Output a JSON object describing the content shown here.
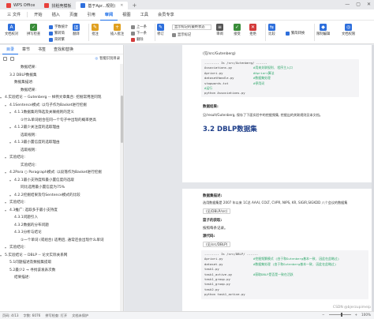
{
  "titlebar": {
    "tabs": [
      {
        "label": "WPS Office",
        "color": "#e8413c",
        "active": false
      },
      {
        "label": "找稻壳模板",
        "color": "#e8413c",
        "active": false
      },
      {
        "label": "基于Apr...规则)",
        "color": "#2e6fdc",
        "active": true
      }
    ],
    "new_tab": "+"
  },
  "menubar": {
    "file": "三 文件",
    "items": [
      "开始",
      "插入",
      "页面",
      "引用",
      "审阅",
      "视图",
      "工具",
      "会员专享"
    ],
    "active": "审阅"
  },
  "ribbon": {
    "buttons": [
      {
        "label": "文档校对",
        "color": "#2e6fdc",
        "glyph": "A"
      },
      {
        "label": "拼写检查",
        "color": "#3a8d3a",
        "glyph": "✓"
      },
      {
        "label": "翻译",
        "color": "#2e6fdc",
        "glyph": "译"
      },
      {
        "label": "批注",
        "color": "#e0a020",
        "glyph": "✎"
      },
      {
        "label": "插入批注",
        "color": "#e0a020",
        "glyph": "+"
      },
      {
        "label": "修订",
        "color": "#2e6fdc",
        "glyph": "✎"
      },
      {
        "label": "审阅",
        "color": "#555555",
        "glyph": "≡"
      },
      {
        "label": "接受",
        "color": "#3a8d3a",
        "glyph": "✓"
      },
      {
        "label": "拒绝",
        "color": "#d33a3a",
        "glyph": "✕"
      },
      {
        "label": "比较",
        "color": "#2e6fdc",
        "glyph": "⇆"
      },
      {
        "label": "限制编辑",
        "color": "#2e6fdc",
        "glyph": "🔒"
      },
      {
        "label": "文档权限",
        "color": "#2e6fdc",
        "glyph": "◎"
      }
    ],
    "small": [
      "字数统计",
      "繁转简",
      "简转繁",
      "显示标记的最终状态",
      "显示标记",
      "上一条",
      "下一条",
      "删除",
      "繁简转换"
    ],
    "combo_value": "显示标记的最终状态"
  },
  "nav": {
    "tabs": [
      "目录",
      "章节",
      "书签",
      "查找和替换"
    ],
    "active_tab": "目录",
    "smart_button": "智能识别目录",
    "items": [
      {
        "text": "数据结果:",
        "level": 4
      },
      {
        "text": "3.2 DBLP数据集",
        "level": 2
      },
      {
        "text": "数据集描述:",
        "level": 3
      },
      {
        "text": "数据结果:",
        "level": 4
      },
      {
        "text": "4.实验结论 -- Gutenberg -- 样例文章集合: 挖掘常用连同现",
        "level": 1,
        "arrow": true
      },
      {
        "text": "4.1Sentence模式: 以句子作为Basket进行挖掘",
        "level": 2,
        "arrow": true
      },
      {
        "text": "4.1.1数据集的筛选及关联规则的定义",
        "level": 3,
        "arrow": true
      },
      {
        "text": "①什么单词组合在同一个句子中出现的概率更高",
        "level": 4
      },
      {
        "text": "4.1.2最少关注度的选取理由",
        "level": 3,
        "arrow": true
      },
      {
        "text": "选取规则:",
        "level": 4
      },
      {
        "text": "4.1.3最小置信度的选取理由",
        "level": 3,
        "arrow": true
      },
      {
        "text": "选取规则:",
        "level": 4
      },
      {
        "text": "实验结论:",
        "level": 2,
        "arrow": true
      },
      {
        "text": "实验结论:",
        "level": 4
      },
      {
        "text": "4.2Para ○ Paragraph模式: 以段落作为Basket进行挖掘",
        "level": 2,
        "arrow": true
      },
      {
        "text": "4.2.1最小支持度和最小置信度的选取",
        "level": 3,
        "arrow": true
      },
      {
        "text": "同比选用最小置信度为75%",
        "level": 4
      },
      {
        "text": "4.2.2挖掘结果及句Sentence模式的比较",
        "level": 3,
        "arrow": true
      },
      {
        "text": "实验结论:",
        "level": 2,
        "arrow": true
      },
      {
        "text": "4.3推广: 选取多于最小支持度",
        "level": 2,
        "arrow": true
      },
      {
        "text": "4.3.1问题引入",
        "level": 3
      },
      {
        "text": "4.3.2数据的分布问题",
        "level": 3
      },
      {
        "text": "4.3.3分析与结论",
        "level": 3
      },
      {
        "text": "①一个单词 (或组合) 适用后, 通常还会出现什么单词",
        "level": 4
      },
      {
        "text": "实验结论:",
        "level": 2,
        "arrow": true
      },
      {
        "text": "5.实验结论 -- DBLP -- 论文实际关系网",
        "level": 1,
        "arrow": true
      },
      {
        "text": "5.1问题描述及数据集提取",
        "level": 2
      },
      {
        "text": "5.2最少2 → 寻找该发表次数",
        "level": 2
      },
      {
        "text": "结果描述:",
        "level": 3
      }
    ]
  },
  "doc": {
    "path1": "(见/src/Gutenberg)",
    "code1": [
      {
        "text": "-------- Is /src/Gutenberg/ ------",
        "comment": ""
      },
      {
        "text": "Associations.py",
        "comment": "#用来关联规则, 程序主入口"
      },
      {
        "text": "Apriori.py",
        "comment": "#Apriori算法"
      },
      {
        "text": "datasetHandle.py",
        "comment": "#数据集处理"
      },
      {
        "text": "stopwords.txt",
        "comment": "#停用词"
      },
      {
        "text": "#运行",
        "comment": ""
      },
      {
        "text": "python Associations.py",
        "comment": ""
      }
    ],
    "result_label": "数据结果:",
    "result_text": "见/result/Gutenberg, 保存了下面实验中的挖掘频集, 挖掘出的关联规则见本文档。",
    "heading": "3.2 DBLP数据集",
    "desc_label": "数据集描述:",
    "desc_text": "选用数据集是 2007 年以来 1C总 AAAI, COLT, CVPR, NIPS, KR, SIGIR,SIGKDD 八个会议的数据集",
    "path2": "(见/DBLP/src)",
    "result2_label": "篮子的获取:",
    "result2_text": "按照每条记录。",
    "source_label": "源代码:",
    "path3": "(见/src/DBLP)",
    "code2": [
      {
        "text": "-------- Is /src/DBLP/ ------",
        "comment": ""
      },
      {
        "text": "Apriori.py",
        "comment": "#挖掘频繁模式 (由于和Gutenberg基本一致, 因此在此略过)"
      },
      {
        "text": "dataset.py",
        "comment": "#数据集处理 (由于和Gutenberg基本一致, 因此在此略过)"
      },
      {
        "text": "task1.py",
        "comment": ""
      },
      {
        "text": "task1_active.py",
        "comment": "#获取DBLP是否是一致在活跃"
      },
      {
        "text": "task1_group.py",
        "comment": ""
      },
      {
        "text": "task1_gruop.py",
        "comment": ""
      },
      {
        "text": "task2.py",
        "comment": ""
      },
      {
        "text": "python task1_active.py",
        "comment": ""
      }
    ]
  },
  "statusbar": {
    "page": "页码: 4/13",
    "words": "字数: 6076",
    "spell": "拼写检查: 打开",
    "proof": "文档未保护",
    "zoom": "100%",
    "zoom_fraction": 0.6
  },
  "watermark": "CSDN @bjerzupimeip"
}
